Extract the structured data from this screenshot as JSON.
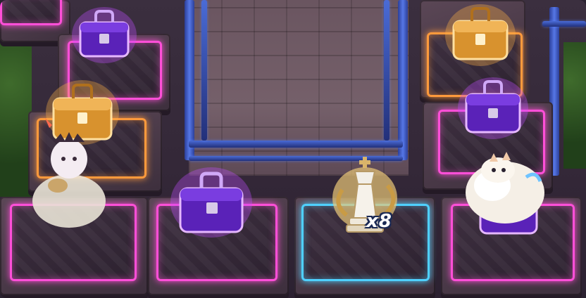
{
  "scene": {
    "name": "treasure-board"
  },
  "reward": {
    "icon": "chess-king-piece-icon",
    "count_label": "x8"
  },
  "chests": [
    {
      "type": "purple",
      "tile": "top-left"
    },
    {
      "type": "gold",
      "tile": "top-right"
    },
    {
      "type": "gold",
      "tile": "mid-left"
    },
    {
      "type": "purple",
      "tile": "mid-right"
    },
    {
      "type": "purple",
      "tile": "bottom-left-center"
    },
    {
      "type": "purple",
      "tile": "bottom-right"
    }
  ],
  "colors": {
    "glow_pink": "#ff4fd8",
    "glow_orange": "#ff9a3c",
    "glow_blue": "#4fd0ff",
    "chest_purple": "#6a2bd1",
    "chest_gold": "#e7a93f",
    "rail_blue": "#3a55c8"
  }
}
